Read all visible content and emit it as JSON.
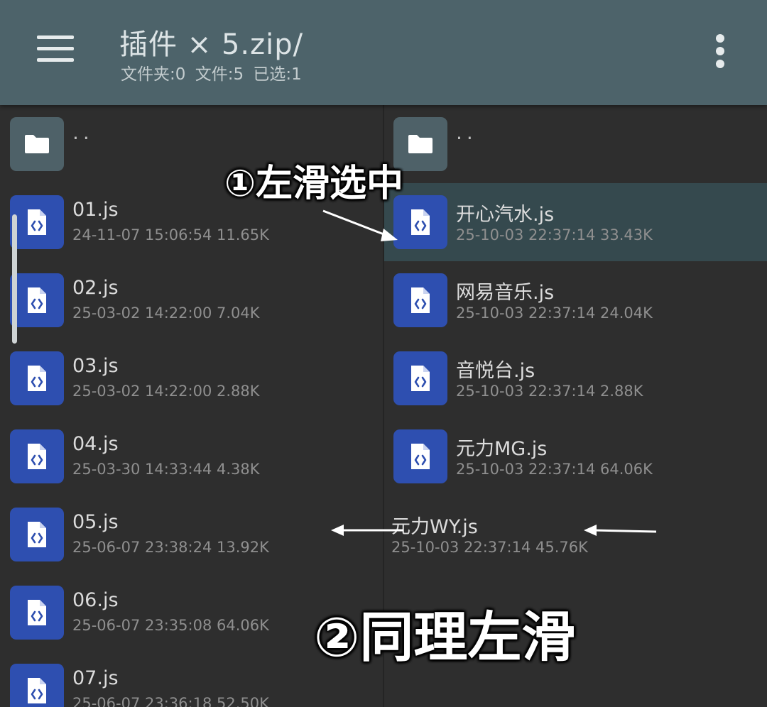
{
  "header": {
    "title": "插件 × 5.zip/",
    "subtitle": "文件夹:0  文件:5  已选:1",
    "menu_icon": "hamburger-menu-icon",
    "overflow_icon": "more-vert-icon"
  },
  "left_pane": {
    "parent": "..",
    "files": [
      {
        "name": "01.js",
        "meta": "24-11-07 15:06:54  11.65K"
      },
      {
        "name": "02.js",
        "meta": "25-03-02 14:22:00  7.04K"
      },
      {
        "name": "03.js",
        "meta": "25-03-02 14:22:00  2.88K"
      },
      {
        "name": "04.js",
        "meta": "25-03-30 14:33:44  4.38K"
      },
      {
        "name": "05.js",
        "meta": "25-06-07 23:38:24  13.92K"
      },
      {
        "name": "06.js",
        "meta": "25-06-07 23:35:08  64.06K"
      },
      {
        "name": "07.js",
        "meta": "25-06-07 23:36:18  52.50K"
      }
    ]
  },
  "right_pane": {
    "parent": "..",
    "files": [
      {
        "name": "开心汽水.js",
        "meta": "25-10-03 22:37:14  33.43K",
        "selected": true
      },
      {
        "name": "网易音乐.js",
        "meta": "25-10-03 22:37:14  24.04K"
      },
      {
        "name": "音悦台.js",
        "meta": "25-10-03 22:37:14  2.88K"
      },
      {
        "name": "元力MG.js",
        "meta": "25-10-03 22:37:14  64.06K"
      },
      {
        "name": "元力WY.js",
        "meta": "25-10-03 22:37:14  45.76K",
        "swiped": true
      }
    ]
  },
  "annotations": {
    "step1": "①左滑选中",
    "step2": "②同理左滑"
  },
  "colors": {
    "appbar": "#4d636a",
    "background": "#2e2e2e",
    "file_icon": "#2e4fb0",
    "folder_icon": "#4e6168",
    "selected_row": "#35494e"
  }
}
